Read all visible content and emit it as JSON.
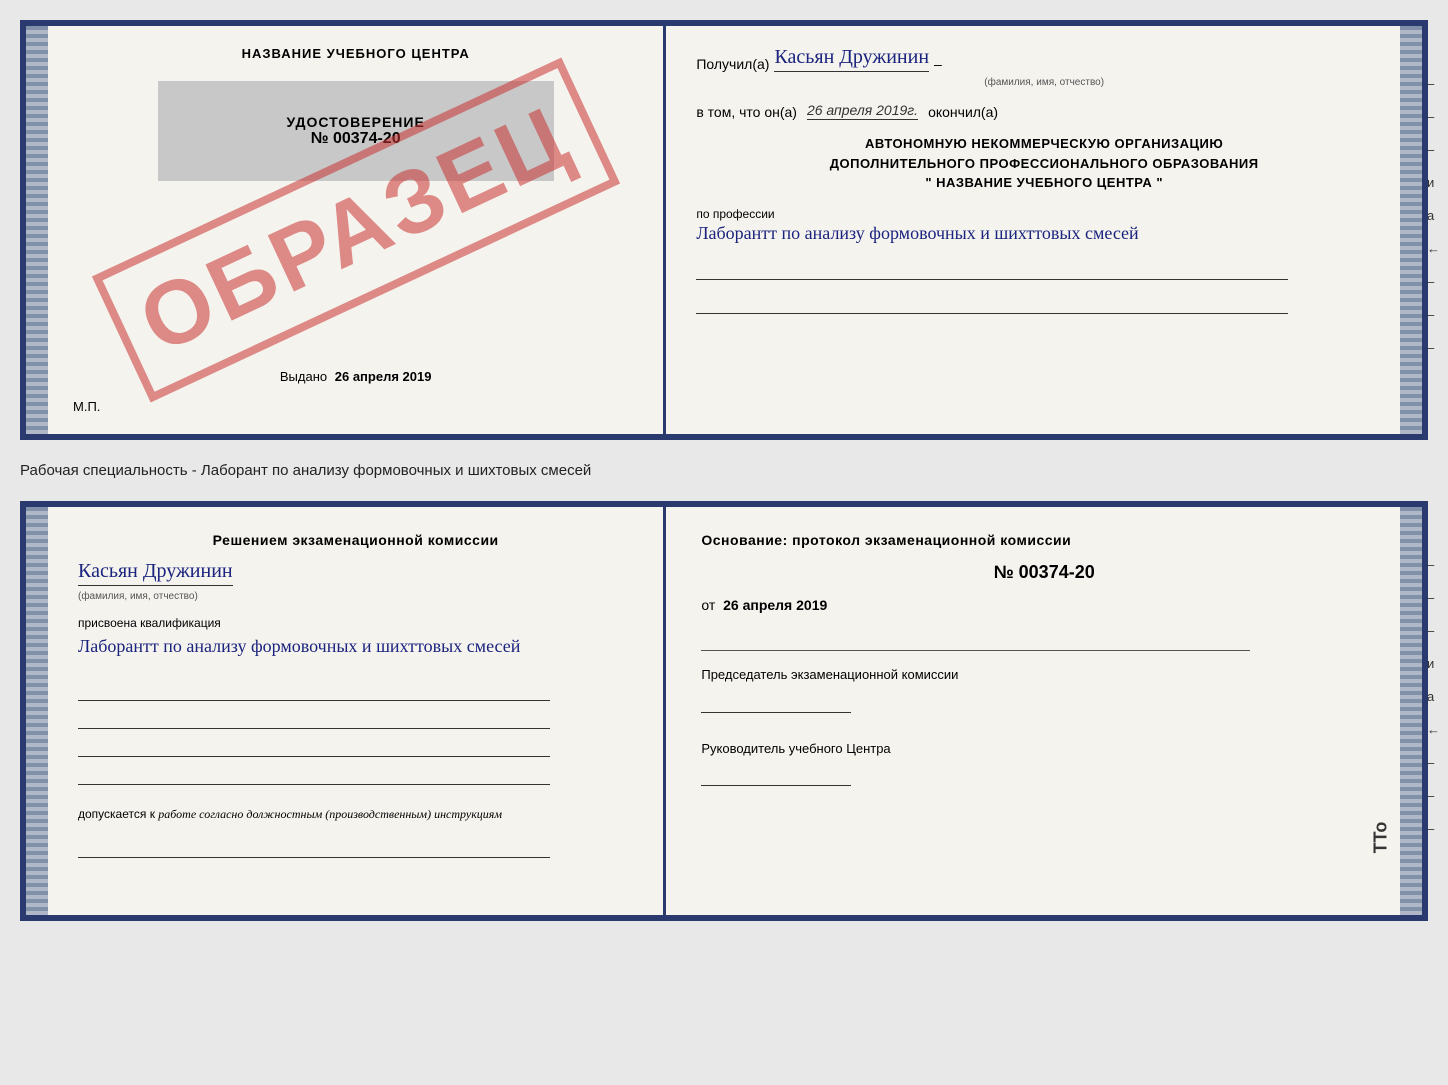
{
  "topDoc": {
    "left": {
      "title": "НАЗВАНИЕ УЧЕБНОГО ЦЕНТРА",
      "stamp": "ОБРАЗЕЦ",
      "udostoverenie_label": "УДОСТОВЕРЕНИЕ",
      "udostoverenie_number": "№ 00374-20",
      "vydano_prefix": "Выдано",
      "vydano_date": "26 апреля 2019",
      "mp": "М.П."
    },
    "right": {
      "poluchil_label": "Получил(а)",
      "recipient_name": "Касьян Дружинин",
      "fio_sub": "(фамилия, имя, отчество)",
      "vtom_label": "в том, что он(а)",
      "vtom_date": "26 апреля 2019г.",
      "okonchil_label": "окончил(а)",
      "org_line1": "АВТОНОМНУЮ НЕКОММЕРЧЕСКУЮ ОРГАНИЗАЦИЮ",
      "org_line2": "ДОПОЛНИТЕЛЬНОГО ПРОФЕССИОНАЛЬНОГО ОБРАЗОВАНИЯ",
      "org_line3": "\"  НАЗВАНИЕ УЧЕБНОГО ЦЕНТРА  \"",
      "po_professii_label": "по профессии",
      "profession_text": "Лаборантт по анализу формовочных и шихттовых смесей",
      "side_marks": [
        "-",
        "-",
        "-",
        "и",
        "а",
        "←",
        "-",
        "-",
        "-"
      ]
    }
  },
  "specialtyLine": "Рабочая специальность - Лаборант по анализу формовочных и шихтовых смесей",
  "bottomDoc": {
    "left": {
      "resheniem_text": "Решением экзаменационной комиссии",
      "fio_name": "Касьян Дружинин",
      "fio_sub": "(фамилия, имя, отчество)",
      "prisvoena_label": "присвоена квалификация",
      "qualification": "Лаборантт по анализу формовочных и шихттовых смесей",
      "dopuskaetsya_prefix": "допускается к",
      "dopusk_text": "работе согласно должностным (производственным) инструкциям"
    },
    "right": {
      "osnovanie_text": "Основание: протокол экзаменационной комиссии",
      "protocol_number": "№ 00374-20",
      "ot_label": "от",
      "protocol_date": "26 апреля 2019",
      "predsedatel_label": "Председатель экзаменационной комиссии",
      "rukovoditel_label": "Руководитель учебного Центра",
      "side_marks": [
        "-",
        "-",
        "-",
        "и",
        "а",
        "←",
        "-",
        "-",
        "-"
      ]
    }
  },
  "tto_mark": "TTo"
}
